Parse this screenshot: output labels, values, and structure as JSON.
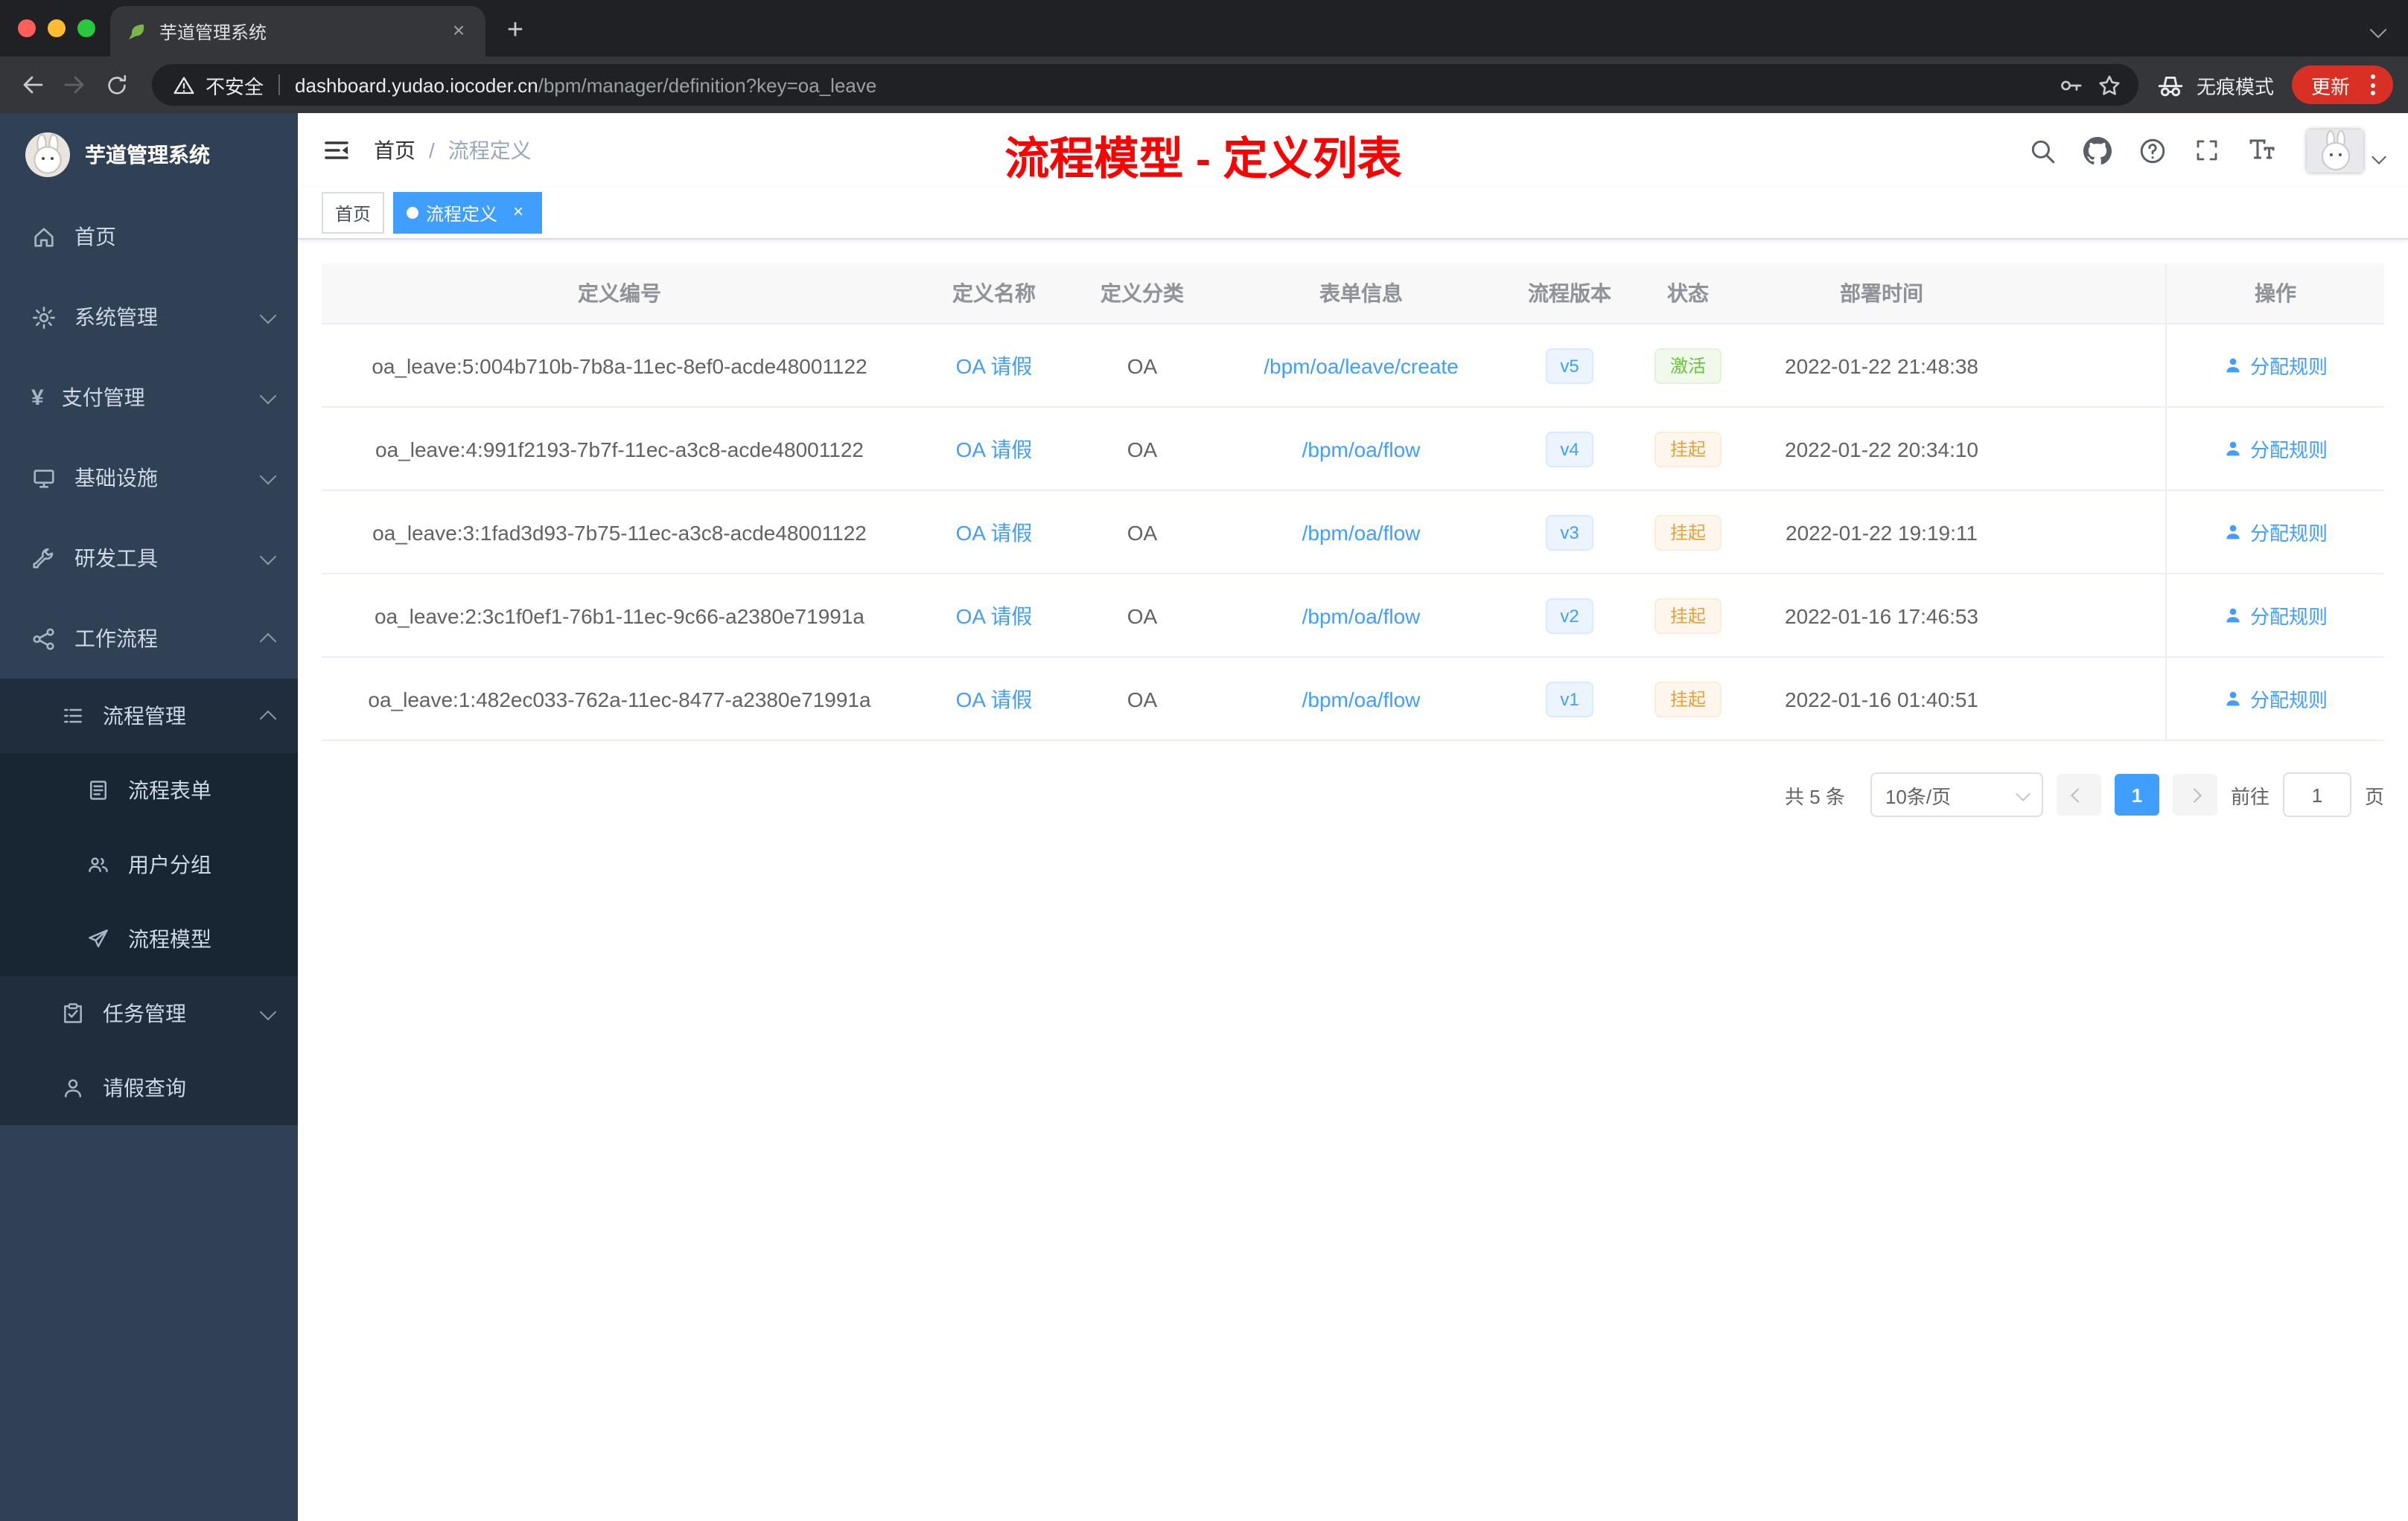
{
  "colors": {
    "accent": "#409eff",
    "annotation_red": "#ff0000",
    "success_green": "#67c23a",
    "warning_orange": "#e6a23c",
    "sidebar_bg": "#304156",
    "active_tag_blue": "#409eff",
    "update_chip_red": "#d93025"
  },
  "browser": {
    "tab_title": "芋道管理系统",
    "security_label": "不安全",
    "url_domain": "dashboard.yudao.iocoder.cn",
    "url_path": "/bpm/manager/definition?key=oa_leave",
    "incognito_label": "无痕模式",
    "update_label": "更新"
  },
  "sidebar": {
    "logo_title": "芋道管理系统",
    "items": [
      {
        "label": "首页"
      },
      {
        "label": "系统管理"
      },
      {
        "label": "支付管理"
      },
      {
        "label": "基础设施"
      },
      {
        "label": "研发工具"
      },
      {
        "label": "工作流程"
      }
    ],
    "workflow_menu": {
      "group_label": "流程管理",
      "group_children": [
        {
          "label": "流程表单"
        },
        {
          "label": "用户分组"
        },
        {
          "label": "流程模型"
        }
      ],
      "siblings": [
        {
          "label": "任务管理"
        },
        {
          "label": "请假查询"
        }
      ]
    }
  },
  "header": {
    "breadcrumb_home": "首页",
    "breadcrumb_separator": "/",
    "breadcrumb_current": "流程定义",
    "annotation": "流程模型 - 定义列表"
  },
  "tags": {
    "home": "首页",
    "active": "流程定义",
    "close": "×"
  },
  "table": {
    "columns": [
      "定义编号",
      "定义名称",
      "定义分类",
      "表单信息",
      "流程版本",
      "状态",
      "部署时间",
      "操作"
    ],
    "action_label": "分配规则",
    "rows": [
      {
        "id": "oa_leave:5:004b710b-7b8a-11ec-8ef0-acde48001122",
        "name": "OA 请假",
        "category": "OA",
        "form": "/bpm/oa/leave/create",
        "version": "v5",
        "status": "激活",
        "status_type": "success",
        "time": "2022-01-22 21:48:38"
      },
      {
        "id": "oa_leave:4:991f2193-7b7f-11ec-a3c8-acde48001122",
        "name": "OA 请假",
        "category": "OA",
        "form": "/bpm/oa/flow",
        "version": "v4",
        "status": "挂起",
        "status_type": "warning",
        "time": "2022-01-22 20:34:10"
      },
      {
        "id": "oa_leave:3:1fad3d93-7b75-11ec-a3c8-acde48001122",
        "name": "OA 请假",
        "category": "OA",
        "form": "/bpm/oa/flow",
        "version": "v3",
        "status": "挂起",
        "status_type": "warning",
        "time": "2022-01-22 19:19:11"
      },
      {
        "id": "oa_leave:2:3c1f0ef1-76b1-11ec-9c66-a2380e71991a",
        "name": "OA 请假",
        "category": "OA",
        "form": "/bpm/oa/flow",
        "version": "v2",
        "status": "挂起",
        "status_type": "warning",
        "time": "2022-01-16 17:46:53"
      },
      {
        "id": "oa_leave:1:482ec033-762a-11ec-8477-a2380e71991a",
        "name": "OA 请假",
        "category": "OA",
        "form": "/bpm/oa/flow",
        "version": "v1",
        "status": "挂起",
        "status_type": "warning",
        "time": "2022-01-16 01:40:51"
      }
    ]
  },
  "pagination": {
    "total": "共 5 条",
    "page_size": "10条/页",
    "page": "1",
    "goto_label": "前往",
    "goto_value": "1",
    "unit": "页"
  }
}
